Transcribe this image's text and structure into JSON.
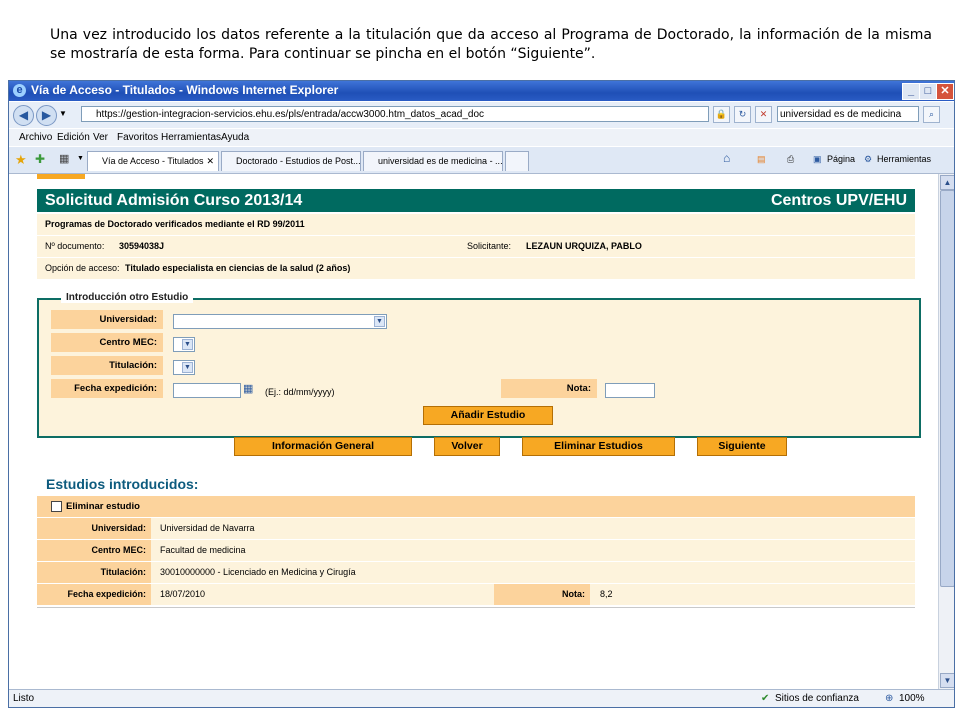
{
  "caption": "Una vez introducido los datos referente a la titulación que da acceso al Programa de Doctorado, la información de la misma se mostraría de esta forma. Para continuar se pincha en el botón “Siguiente”.",
  "window": {
    "title": "Vía de Acceso - Titulados - Windows Internet Explorer",
    "url": "https://gestion-integracion-servicios.ehu.es/pls/entrada/accw3000.htm_datos_acad_doc",
    "search": "universidad es de medicina"
  },
  "menu": [
    "Archivo",
    "Edición",
    "Ver",
    "Favoritos",
    "Herramientas",
    "Ayuda"
  ],
  "tabs": [
    "Vía de Acceso - Titulados",
    "Doctorado - Estudios de Post...",
    "universidad es de medicina - ..."
  ],
  "toolbar": {
    "page": "Página",
    "tools": "Herramientas"
  },
  "page": {
    "title": "Solicitud Admisión Curso 2013/14",
    "org": "Centros UPV/EHU",
    "program": "Programas de Doctorado verificados mediante el RD 99/2011",
    "doc_label": "Nº documento:",
    "doc_value": "30594038J",
    "applicant_label": "Solicitante:",
    "applicant_value": "LEZAUN URQUIZA, PABLO",
    "access_label": "Opción de acceso:",
    "access_value": "Titulado especialista en ciencias de la salud (2 años)"
  },
  "form": {
    "legend": "Introducción otro Estudio",
    "university_label": "Universidad:",
    "center_label": "Centro MEC:",
    "degree_label": "Titulación:",
    "date_label": "Fecha expedición:",
    "date_hint": "(Ej.: dd/mm/yyyy)",
    "grade_label": "Nota:",
    "add_button": "Añadir Estudio"
  },
  "actions": {
    "general_info": "Información General",
    "back": "Volver",
    "delete": "Eliminar Estudios",
    "next": "Siguiente"
  },
  "studies": {
    "title": "Estudios introducidos:",
    "delete_label": "Eliminar estudio",
    "university_label": "Universidad:",
    "university": "Universidad de Navarra",
    "center_label": "Centro MEC:",
    "center": "Facultad de medicina",
    "degree_label": "Titulación:",
    "degree": "30010000000 - Licenciado en Medicina y Cirugía",
    "date_label": "Fecha expedición:",
    "date": "18/07/2010",
    "grade_label": "Nota:",
    "grade": "8,2"
  },
  "status": {
    "left": "Listo",
    "zone": "Sitios de confianza",
    "zoom": "100%"
  }
}
